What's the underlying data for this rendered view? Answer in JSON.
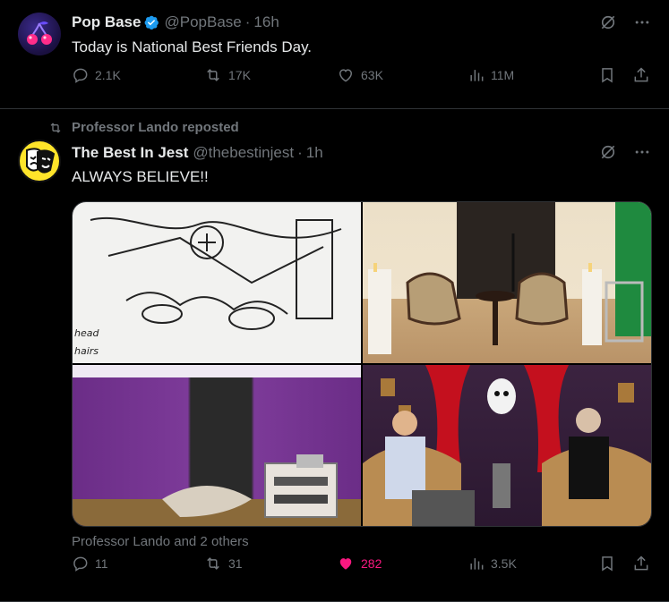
{
  "tweets": [
    {
      "display_name": "Pop Base",
      "handle": "@PopBase",
      "separator": "·",
      "time": "16h",
      "text": "Today is National Best Friends Day.",
      "actions": {
        "replies": "2.1K",
        "reposts": "17K",
        "likes": "63K",
        "views": "11M"
      }
    },
    {
      "repost_label": "Professor Lando reposted",
      "display_name": "The Best In Jest",
      "handle": "@thebestinjest",
      "separator": "·",
      "time": "1h",
      "text": "ALWAYS BELIEVE!!",
      "media_handwriting": [
        "head",
        "hairs"
      ],
      "reposted_by": "Professor Lando and 2 others",
      "actions": {
        "replies": "11",
        "reposts": "31",
        "likes": "282",
        "views": "3.5K"
      }
    }
  ],
  "colors": {
    "background": "#000000",
    "text_primary": "#e7e9ea",
    "text_secondary": "#71767b",
    "verified_blue": "#1d9bf0",
    "like_pink": "#f91880",
    "divider": "#2f3336"
  },
  "icons": [
    "verified-icon",
    "grok-icon",
    "more-icon",
    "reply-icon",
    "repost-icon",
    "like-icon",
    "views-icon",
    "bookmark-icon",
    "share-icon"
  ]
}
